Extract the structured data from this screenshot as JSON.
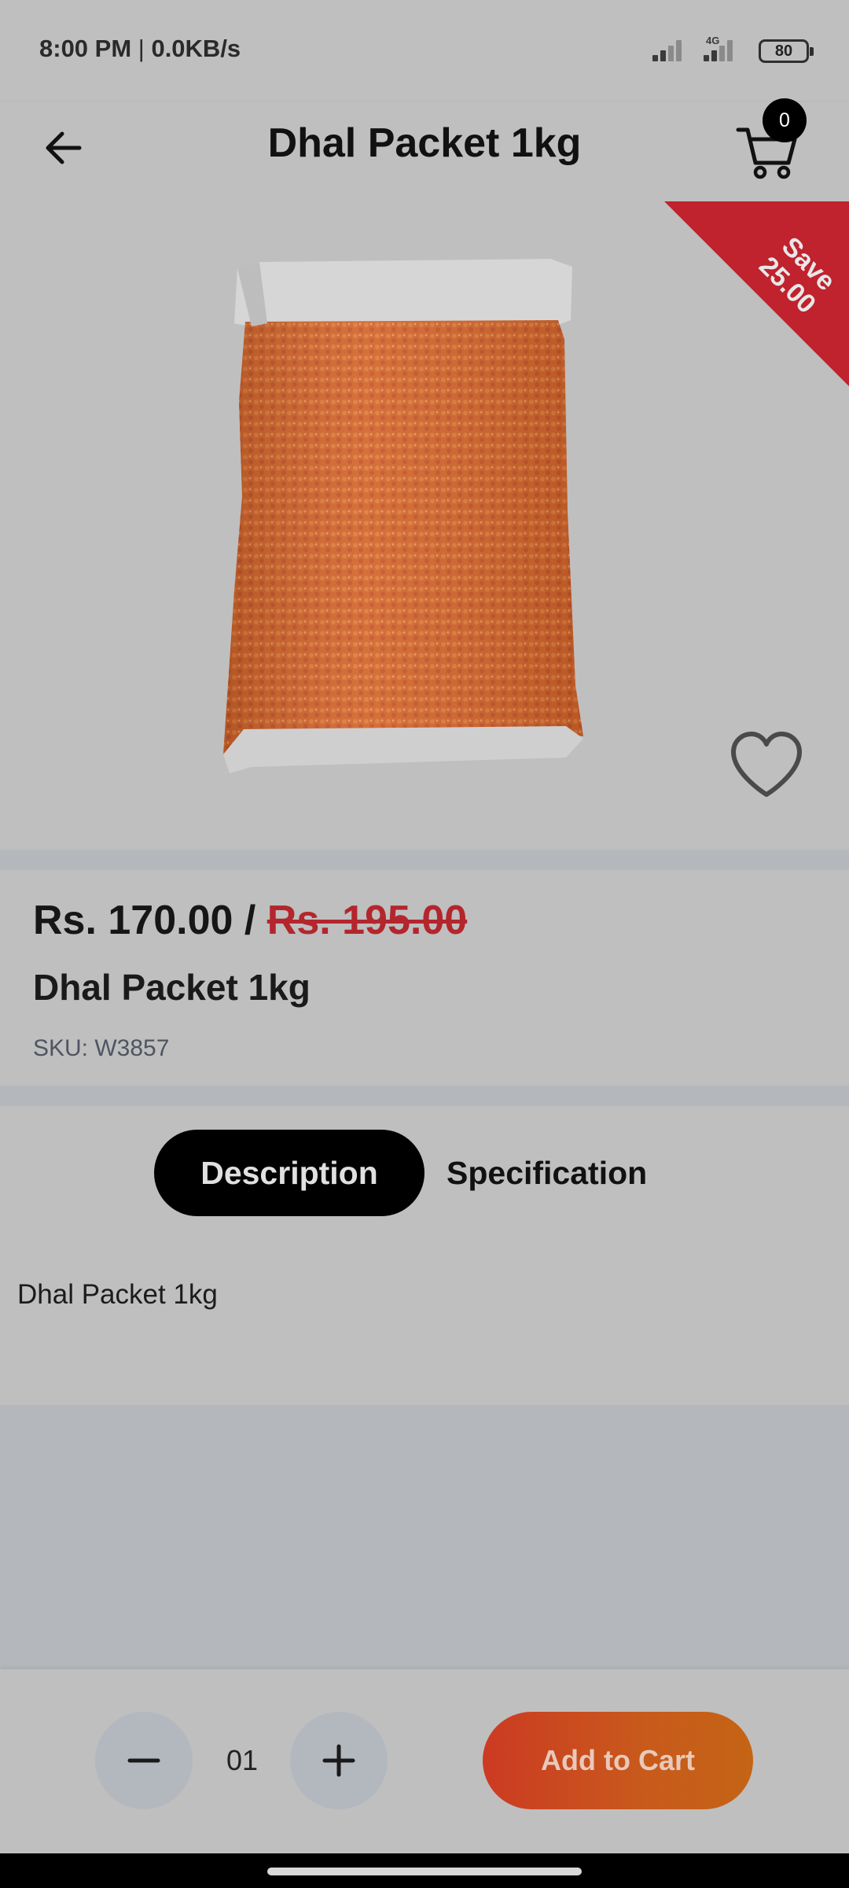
{
  "status_bar": {
    "time": "8:00 PM",
    "separator": " | ",
    "speed": "0.0KB/s",
    "network_label": "4G",
    "battery": "80"
  },
  "header": {
    "title": "Dhal Packet 1kg",
    "cart_count": "0"
  },
  "product": {
    "save_label": "Save",
    "save_amount": "25.00",
    "price": "Rs. 170.00",
    "price_separator": " / ",
    "old_price": "Rs. 195.00",
    "name": "Dhal Packet 1kg",
    "sku": "SKU: W3857"
  },
  "tabs": {
    "description": "Description",
    "specification": "Specification",
    "active": "Description"
  },
  "description_text": "Dhal Packet 1kg",
  "cart_controls": {
    "quantity": "01",
    "add_to_cart": "Add to Cart"
  },
  "colors": {
    "accent_gradient_start": "#cc3a22",
    "accent_gradient_end": "#c46414",
    "old_price_red": "#b3262d",
    "ribbon_red": "#c0222e",
    "active_tab": "#000000"
  }
}
